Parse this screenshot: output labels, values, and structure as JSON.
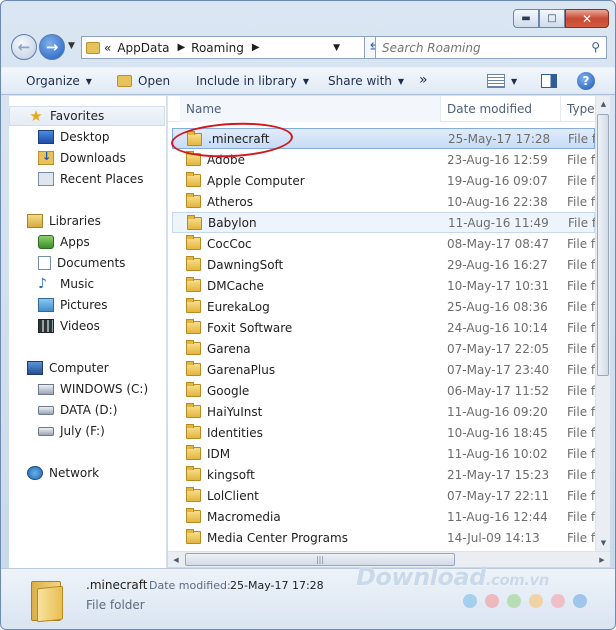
{
  "window": {
    "caption_buttons": [
      "minimize",
      "maximize",
      "close"
    ]
  },
  "address": {
    "overflow": "«",
    "crumbs": [
      "AppData",
      "Roaming"
    ]
  },
  "search": {
    "placeholder": "Search Roaming"
  },
  "toolbar": {
    "organize": "Organize",
    "open": "Open",
    "include": "Include in library",
    "share": "Share with",
    "more": "»"
  },
  "nav": {
    "favorites": "Favorites",
    "desktop": "Desktop",
    "downloads": "Downloads",
    "recent": "Recent Places",
    "libraries": "Libraries",
    "apps": "Apps",
    "documents": "Documents",
    "music": "Music",
    "pictures": "Pictures",
    "videos": "Videos",
    "computer": "Computer",
    "drive_c": "WINDOWS (C:)",
    "drive_d": "DATA (D:)",
    "drive_f": "July (F:)",
    "network": "Network"
  },
  "columns": {
    "name": "Name",
    "date": "Date modified",
    "type": "Type"
  },
  "files": [
    {
      "name": ".minecraft",
      "date": "25-May-17 17:28",
      "type": "File fo"
    },
    {
      "name": "Adobe",
      "date": "23-Aug-16 12:59",
      "type": "File fo"
    },
    {
      "name": "Apple Computer",
      "date": "19-Aug-16 09:07",
      "type": "File fo"
    },
    {
      "name": "Atheros",
      "date": "10-Aug-16 22:38",
      "type": "File fo"
    },
    {
      "name": "Babylon",
      "date": "11-Aug-16 11:49",
      "type": "File fo"
    },
    {
      "name": "CocCoc",
      "date": "08-May-17 08:47",
      "type": "File fo"
    },
    {
      "name": "DawningSoft",
      "date": "29-Aug-16 16:27",
      "type": "File fo"
    },
    {
      "name": "DMCache",
      "date": "10-May-17 10:31",
      "type": "File fo"
    },
    {
      "name": "EurekaLog",
      "date": "25-Aug-16 08:36",
      "type": "File fo"
    },
    {
      "name": "Foxit Software",
      "date": "24-Aug-16 10:14",
      "type": "File fo"
    },
    {
      "name": "Garena",
      "date": "07-May-17 22:05",
      "type": "File fo"
    },
    {
      "name": "GarenaPlus",
      "date": "07-May-17 23:40",
      "type": "File fo"
    },
    {
      "name": "Google",
      "date": "06-May-17 11:52",
      "type": "File fo"
    },
    {
      "name": "HaiYuInst",
      "date": "11-Aug-16 09:20",
      "type": "File fo"
    },
    {
      "name": "Identities",
      "date": "10-Aug-16 18:45",
      "type": "File fo"
    },
    {
      "name": "IDM",
      "date": "11-Aug-16 10:02",
      "type": "File fo"
    },
    {
      "name": "kingsoft",
      "date": "21-May-17 15:23",
      "type": "File fo"
    },
    {
      "name": "LolClient",
      "date": "07-May-17 22:11",
      "type": "File fo"
    },
    {
      "name": "Macromedia",
      "date": "11-Aug-16 12:44",
      "type": "File fo"
    },
    {
      "name": "Media Center Programs",
      "date": "14-Jul-09 14:13",
      "type": "File fo"
    }
  ],
  "details": {
    "name": ".minecraft",
    "date_label": "Date modified:",
    "date": "25-May-17 17:28",
    "type": "File folder"
  },
  "watermark": {
    "main": "Download",
    "suffix": ".com.vn"
  },
  "watermark_dots": [
    "#8fc6ea",
    "#f0a8a8",
    "#a8d8a0",
    "#f3c98a",
    "#f2b0b8",
    "#8ab8e8"
  ]
}
